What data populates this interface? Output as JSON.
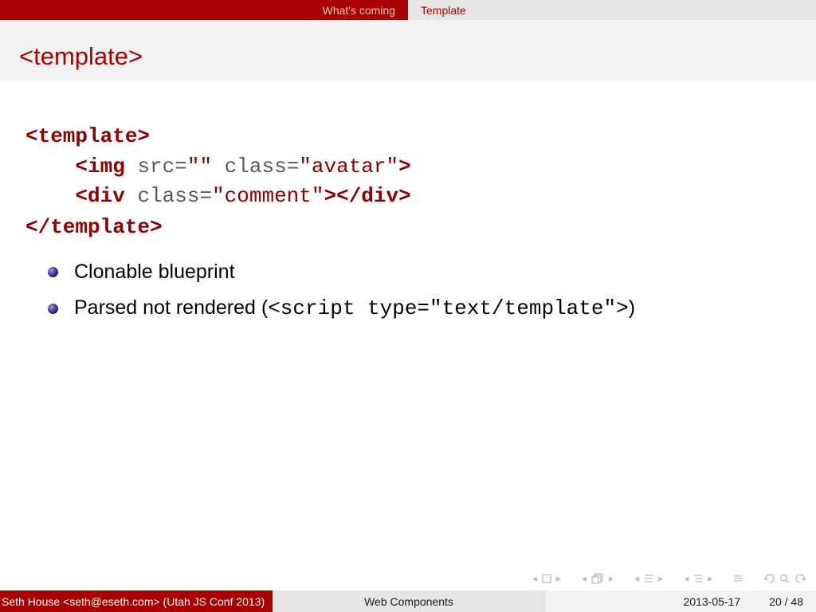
{
  "nav": {
    "sections": [
      "What's coming",
      "Template"
    ]
  },
  "frame": {
    "title": "<template>"
  },
  "code": {
    "line1_tag": "<template>",
    "line2_indent": "    ",
    "line2_tag": "<img",
    "line2_attr1": " src=",
    "line2_val1": "\"\"",
    "line2_attr2": " class=",
    "line2_val2": "\"avatar\"",
    "line2_close": ">",
    "line3_indent": "    ",
    "line3_tag": "<div",
    "line3_attr": " class=",
    "line3_val": "\"comment\"",
    "line3_close": "></div>",
    "line4_tag": "</template>"
  },
  "bullets": {
    "item1": "Clonable blueprint",
    "item2_text": "Parsed not rendered (",
    "item2_code": "<script type=\"text/template\">",
    "item2_end": ")"
  },
  "footer": {
    "author": "Seth House <seth@eseth.com>  (Utah JS Conf 2013)",
    "title": "Web Components",
    "date": "2013-05-17",
    "page": "20 / 48"
  },
  "colors": {
    "accent": "#a80000",
    "nav_bg": "#e5e5e5",
    "title_bg": "#f2f2f2"
  }
}
